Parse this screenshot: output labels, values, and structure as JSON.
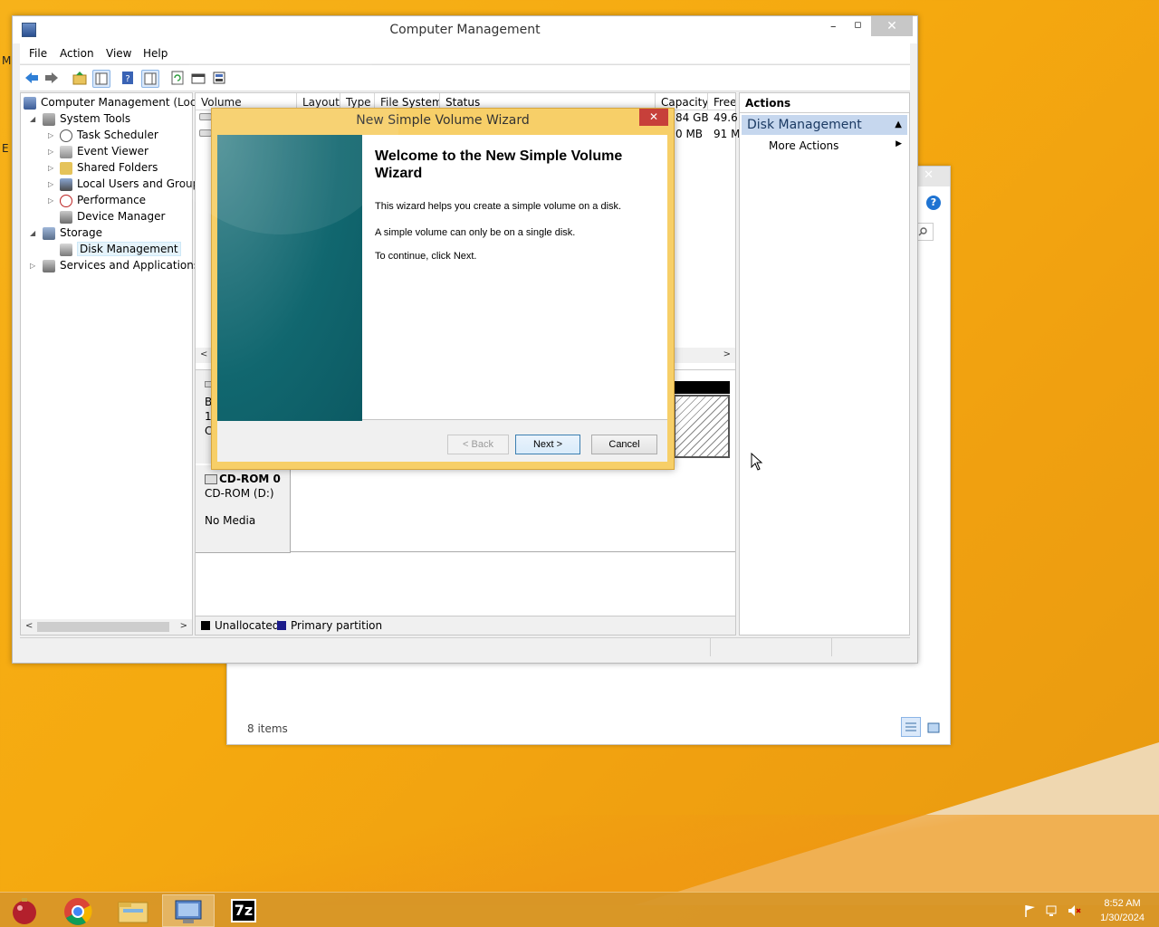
{
  "desktop": {
    "left_letters": [
      "M",
      "E"
    ]
  },
  "background_window": {
    "status": "8 items"
  },
  "computer_management": {
    "title": "Computer Management",
    "menu": [
      "File",
      "Action",
      "View",
      "Help"
    ],
    "tree": {
      "root": "Computer Management (Local",
      "system_tools": "System Tools",
      "task_scheduler": "Task Scheduler",
      "event_viewer": "Event Viewer",
      "shared_folders": "Shared Folders",
      "local_users": "Local Users and Groups",
      "performance": "Performance",
      "device_manager": "Device Manager",
      "storage": "Storage",
      "disk_management": "Disk Management",
      "services": "Services and Applications"
    },
    "columns": [
      "Volume",
      "Layout",
      "Type",
      "File System",
      "Status",
      "Capacity",
      "Free"
    ],
    "rows": [
      {
        "capacity": "84 GB",
        "free": "49.6"
      },
      {
        "capacity": "0 MB",
        "free": "91 M"
      }
    ],
    "disk0_fragments": [
      "B",
      "1",
      "C"
    ],
    "cdrom": {
      "name": "CD-ROM 0",
      "drive": "CD-ROM (D:)",
      "media": "No Media"
    },
    "legend": {
      "unallocated": "Unallocated",
      "primary": "Primary partition"
    },
    "legend_colors": {
      "unallocated": "#000000",
      "primary": "#1b1b8a"
    },
    "actions": {
      "header": "Actions",
      "section": "Disk Management",
      "more": "More Actions"
    }
  },
  "wizard": {
    "title": "New Simple Volume Wizard",
    "heading": "Welcome to the New Simple Volume Wizard",
    "paragraphs": [
      "This wizard helps you create a simple volume on a disk.",
      "A simple volume can only be on a single disk.",
      "To continue, click Next."
    ],
    "buttons": {
      "back": "< Back",
      "next": "Next >",
      "cancel": "Cancel"
    }
  },
  "taskbar": {
    "apps": [
      "ornament-app-icon",
      "chrome-icon",
      "file-explorer-icon",
      "computer-management-icon",
      "7zip-icon"
    ],
    "seven_zip_label": "7z",
    "time": "8:52 AM",
    "date": "1/30/2024"
  }
}
